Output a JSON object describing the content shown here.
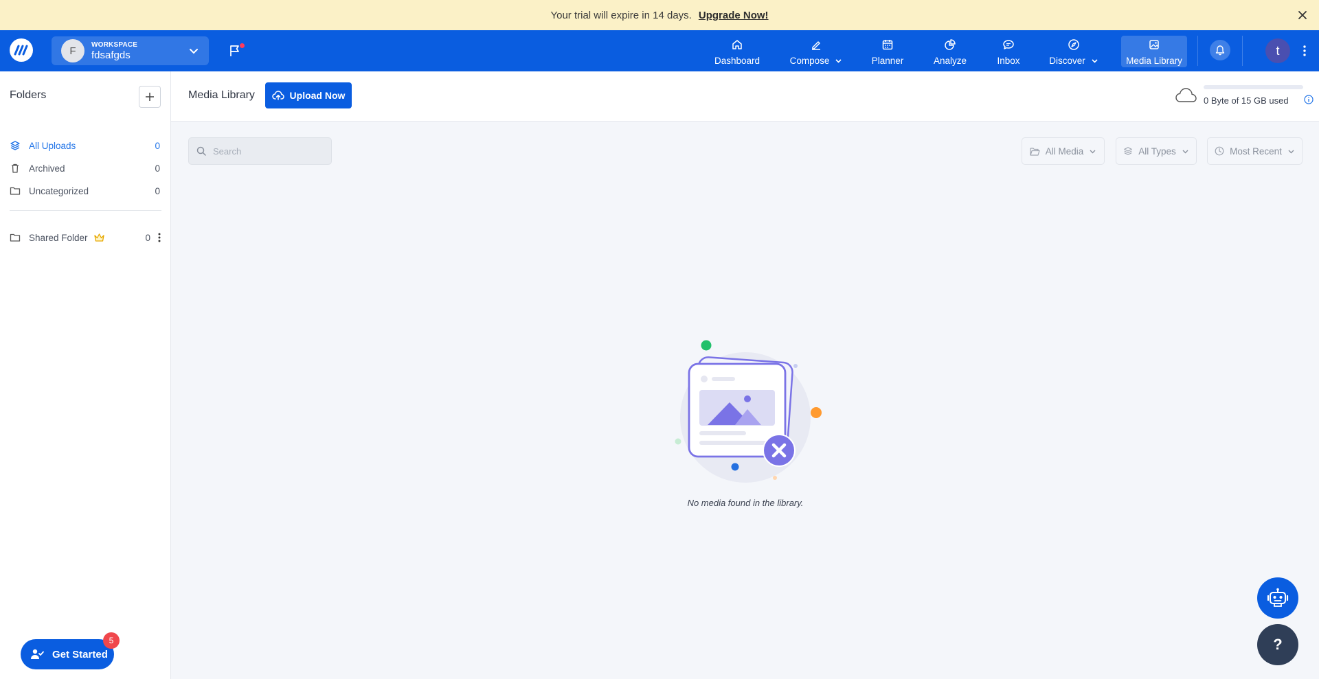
{
  "banner": {
    "message": "Your trial will expire in 14 days.",
    "link": "Upgrade Now!"
  },
  "workspace": {
    "label": "WORKSPACE",
    "name": "fdsafgds",
    "initial": "F"
  },
  "nav": {
    "dashboard": "Dashboard",
    "compose": "Compose",
    "planner": "Planner",
    "analyze": "Analyze",
    "inbox": "Inbox",
    "discover": "Discover",
    "media_library": "Media Library"
  },
  "user": {
    "initial": "t"
  },
  "sidebar": {
    "title": "Folders",
    "folders": [
      {
        "label": "All Uploads",
        "count": "0",
        "icon": "layers-icon"
      },
      {
        "label": "Archived",
        "count": "0",
        "icon": "trash-icon"
      },
      {
        "label": "Uncategorized",
        "count": "0",
        "icon": "folder-icon"
      }
    ],
    "shared": {
      "label": "Shared Folder",
      "count": "0",
      "icon": "crown-icon"
    }
  },
  "get_started": {
    "label": "Get Started",
    "badge": "5"
  },
  "main": {
    "title": "Media Library",
    "upload_label": "Upload Now",
    "storage_text": "0 Byte of 15 GB used",
    "storage_used_fraction": 0
  },
  "toolbar": {
    "search_placeholder": "Search",
    "filters": {
      "media": "All Media",
      "types": "All Types",
      "sort": "Most Recent"
    }
  },
  "empty_state": {
    "message": "No media found in the library."
  },
  "help": {
    "label": "?"
  },
  "colors": {
    "primary": "#0a5de0",
    "banner": "#fbf1c7",
    "active_folder": "#1f73e8"
  }
}
